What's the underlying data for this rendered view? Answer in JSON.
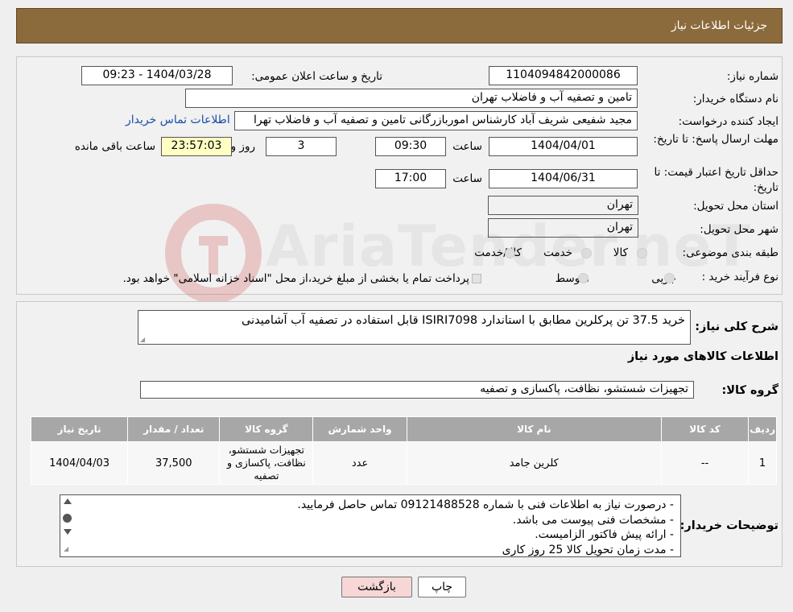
{
  "header": {
    "title": "جزئیات اطلاعات نیاز"
  },
  "fields": {
    "need_number_label": "شماره نیاز:",
    "need_number": "1104094842000086",
    "announce_label": "تاریخ و ساعت اعلان عمومی:",
    "announce_value": "1404/03/28 - 09:23",
    "buyer_org_label": "نام دستگاه خریدار:",
    "buyer_org": "تامین و تصفیه آب و فاضلاب تهران",
    "creator_label": "ایجاد کننده درخواست:",
    "creator": "مجید شفیعی شریف آباد کارشناس اموربازرگانی تامین و تصفیه آب و فاضلاب تهرا",
    "contact_link": "اطلاعات تماس خریدار",
    "deadline_label": "مهلت ارسال پاسخ: تا تاریخ:",
    "deadline_date": "1404/04/01",
    "time_label": "ساعت",
    "deadline_time": "09:30",
    "days": "3",
    "days_label": "روز و",
    "remaining": "23:57:03",
    "remaining_label": "ساعت باقی مانده",
    "validity_label": "حداقل تاریخ اعتبار قیمت: تا تاریخ:",
    "validity_date": "1404/06/31",
    "validity_time": "17:00",
    "province_label": "استان محل تحویل:",
    "province": "تهران",
    "city_label": "شهر محل تحویل:",
    "city": "تهران",
    "category_label": "طبقه بندی موضوعی:",
    "category_options": [
      "کالا",
      "خدمت",
      "کالا/خدمت"
    ],
    "process_label": "نوع فرآیند خرید :",
    "process_options": [
      "جزیی",
      "متوسط"
    ],
    "process_note": "پرداخت تمام یا بخشی از مبلغ خرید،از محل \"اسناد خزانه اسلامی\" خواهد بود."
  },
  "description": {
    "label": "شرح کلی نیاز:",
    "value": "خرید 37.5 تن پرکلرین مطابق با استاندارد ISIRI7098 قابل استفاده در تصفیه آب آشامیدنی"
  },
  "goods_section_title": "اطلاعات کالاهای مورد نیاز",
  "goods_group": {
    "label": "گروه کالا:",
    "value": "تجهیزات شستشو، نظافت، پاکسازی و تصفیه"
  },
  "table": {
    "headers": [
      "ردیف",
      "کد کالا",
      "نام کالا",
      "واحد شمارش",
      "گروه کالا",
      "تعداد / مقدار",
      "تاریخ نیاز"
    ],
    "rows": [
      [
        "1",
        "--",
        "کلرین جامد",
        "عدد",
        "تجهیزات شستشو، نظافت، پاکسازی و تصفیه",
        "37,500",
        "1404/04/03"
      ]
    ]
  },
  "buyer_notes": {
    "label": "توضیحات خریدار:",
    "lines": [
      "- درصورت نیاز به اطلاعات فنی با شماره 09121488528 تماس حاصل فرمایید.",
      "- مشخصات فنی پیوست می باشد.",
      "- ارائه پیش فاکتور الزامیست.",
      "- مدت زمان تحویل کالا 25 روز کاری"
    ]
  },
  "buttons": {
    "print": "چاپ",
    "back": "بازگشت"
  },
  "watermark": "AriaTender.neT",
  "colors": {
    "header": "#8b6a3c",
    "link": "#1a4ea6",
    "back_button": "#f7d6d6",
    "remaining_bg": "#ffffc4"
  }
}
